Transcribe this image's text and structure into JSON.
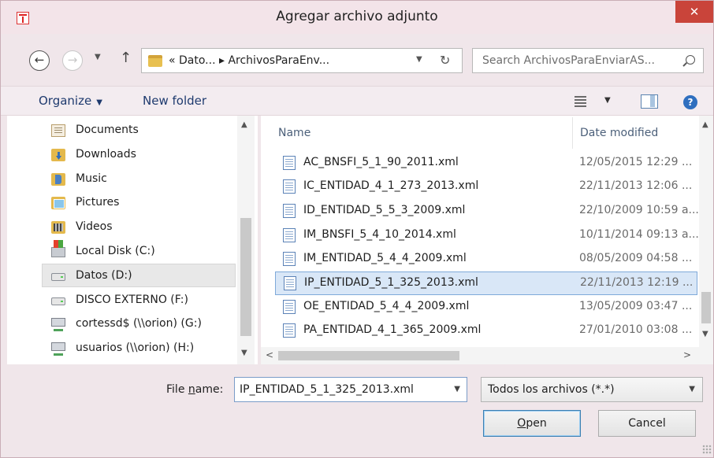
{
  "window": {
    "title": "Agregar archivo adjunto",
    "close_glyph": "✕"
  },
  "address": {
    "back_glyph": "←",
    "forward_glyph": "→",
    "up_glyph": "↑",
    "path_text": "« Dato... ▸ ArchivosParaEnv...",
    "search_placeholder": "Search ArchivosParaEnviarAS..."
  },
  "toolbar": {
    "organize_label": "Organize",
    "new_folder_label": "New folder"
  },
  "nav": {
    "items": [
      {
        "label": "Documents",
        "icon": "documents-icon"
      },
      {
        "label": "Downloads",
        "icon": "downloads-icon"
      },
      {
        "label": "Music",
        "icon": "music-icon"
      },
      {
        "label": "Pictures",
        "icon": "pictures-icon"
      },
      {
        "label": "Videos",
        "icon": "videos-icon"
      },
      {
        "label": "Local Disk (C:)",
        "icon": "local-disk-icon"
      },
      {
        "label": "Datos (D:)",
        "icon": "drive-icon",
        "selected": true
      },
      {
        "label": "DISCO EXTERNO (F:)",
        "icon": "drive-icon"
      },
      {
        "label": "cortessd$ (\\\\orion) (G:)",
        "icon": "network-drive-icon"
      },
      {
        "label": "usuarios (\\\\orion) (H:)",
        "icon": "network-drive-icon"
      }
    ]
  },
  "files": {
    "columns": {
      "name": "Name",
      "date": "Date modified"
    },
    "rows": [
      {
        "name": "AC_BNSFI_5_1_90_2011.xml",
        "date": "12/05/2015 12:29 ..."
      },
      {
        "name": "IC_ENTIDAD_4_1_273_2013.xml",
        "date": "22/11/2013 12:06 ..."
      },
      {
        "name": "ID_ENTIDAD_5_5_3_2009.xml",
        "date": "22/10/2009 10:59 a..."
      },
      {
        "name": "IM_BNSFI_5_4_10_2014.xml",
        "date": "10/11/2014 09:13 a..."
      },
      {
        "name": "IM_ENTIDAD_5_4_4_2009.xml",
        "date": "08/05/2009 04:58 ..."
      },
      {
        "name": "IP_ENTIDAD_5_1_325_2013.xml",
        "date": "22/11/2013 12:19 ...",
        "selected": true
      },
      {
        "name": "OE_ENTIDAD_5_4_4_2009.xml",
        "date": "13/05/2009 03:47 ..."
      },
      {
        "name": "PA_ENTIDAD_4_1_365_2009.xml",
        "date": "27/01/2010 03:08 ..."
      }
    ]
  },
  "bottom": {
    "file_name_label_pre": "File ",
    "file_name_label_u": "n",
    "file_name_label_post": "ame:",
    "file_name_value": "IP_ENTIDAD_5_1_325_2013.xml",
    "filter_value": "Todos los archivos (*.*)",
    "open_u": "O",
    "open_rest": "pen",
    "cancel_label": "Cancel"
  },
  "colors": {
    "accent": "#2f6fbf",
    "selection": "#d9e7f7",
    "close": "#c9443a"
  }
}
